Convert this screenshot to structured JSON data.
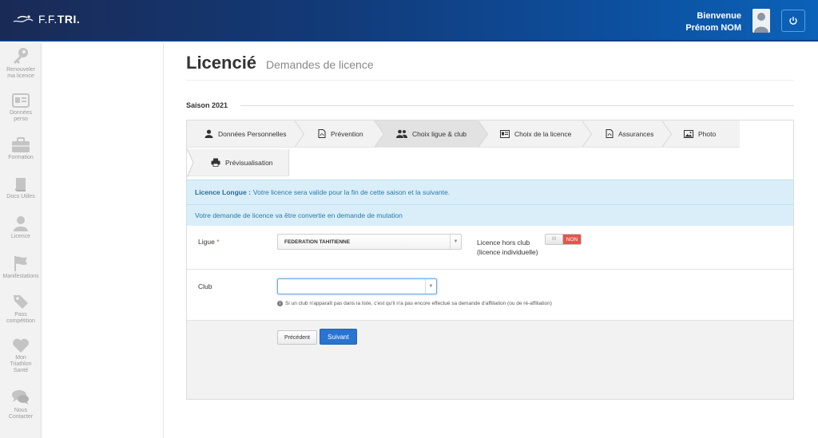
{
  "header": {
    "logo_text_prefix": "F.F.",
    "logo_text_bold": "TRI.",
    "welcome_line1": "Bienvenue",
    "welcome_line2": "Prénom NOM"
  },
  "rail": {
    "items": [
      {
        "label_l1": "Renouveler",
        "label_l2": "ma licence",
        "icon": "key-icon"
      },
      {
        "label_l1": "Données",
        "label_l2": "perso",
        "icon": "id-card-icon"
      },
      {
        "label_l1": "Formation",
        "label_l2": "",
        "icon": "briefcase-icon"
      },
      {
        "label_l1": "Docs Utiles",
        "label_l2": "",
        "icon": "book-icon"
      },
      {
        "label_l1": "Licence",
        "label_l2": "",
        "icon": "user-icon"
      },
      {
        "label_l1": "Manifestations",
        "label_l2": "",
        "icon": "flag-icon"
      },
      {
        "label_l1": "Pass",
        "label_l2": "compétition",
        "icon": "tag-icon"
      },
      {
        "label_l1": "Mon",
        "label_l2": "Triathlon",
        "label_l3": "Santé",
        "icon": "heart-icon"
      },
      {
        "label_l1": "Nous",
        "label_l2": "Contacter",
        "icon": "chat-icon"
      }
    ]
  },
  "page": {
    "title": "Licencié",
    "subtitle": "Demandes de licence",
    "season": "Saison 2021"
  },
  "tabs": [
    {
      "label": "Données Personnelles",
      "icon": "user-icon"
    },
    {
      "label": "Prévention",
      "icon": "pdf-icon"
    },
    {
      "label": "Choix ligue & club",
      "icon": "users-icon",
      "active": true
    },
    {
      "label": "Choix de la licence",
      "icon": "card-icon"
    },
    {
      "label": "Assurances",
      "icon": "pdf-icon"
    },
    {
      "label": "Photo",
      "icon": "image-icon"
    },
    {
      "label": "Prévisualisation",
      "icon": "print-icon"
    }
  ],
  "alerts": {
    "line1_bold": "Licence Longue :",
    "line1_text": "Votre licence sera valide pour la fin de cette saison et la suivante.",
    "line2_text": "Votre demande de licence va être convertie en demande de mutation"
  },
  "form": {
    "ligue_label": "Ligue",
    "ligue_required": "*",
    "ligue_value": "FEDERATION TAHITIENNE",
    "hors_club_label_l1": "Licence hors club",
    "hors_club_label_l2": "(licence individuelle)",
    "toggle_knob": "III",
    "toggle_value": "NON",
    "club_label": "Club",
    "club_value": "",
    "help_text": "Si un club n'apparaît pas dans la liste, c'est qu'il n'a pas encore effectué sa demande d'affiliation (ou de ré-affiliation)"
  },
  "buttons": {
    "prev": "Précédent",
    "next": "Suivant"
  }
}
